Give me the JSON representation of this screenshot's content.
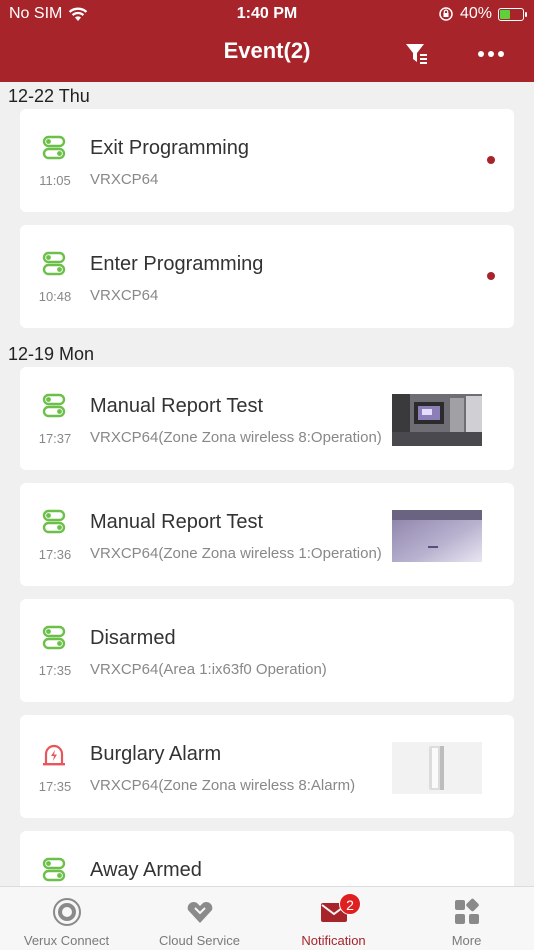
{
  "status_bar": {
    "carrier": "No SIM",
    "time": "1:40 PM",
    "battery": "40%",
    "battery_level": 0.4
  },
  "nav": {
    "title": "Event(2)",
    "filter_icon": "filter-icon",
    "more_icon": "more-icon"
  },
  "groups": [
    {
      "date": "12-22 Thu",
      "events": [
        {
          "title": "Exit Programming",
          "time": "11:05",
          "detail": "VRXCP64",
          "unread": true,
          "icon": "programming-icon"
        },
        {
          "title": "Enter Programming",
          "time": "10:48",
          "detail": "VRXCP64",
          "unread": true,
          "icon": "programming-icon"
        }
      ]
    },
    {
      "date": "12-19 Mon",
      "events": [
        {
          "title": "Manual Report Test",
          "time": "17:37",
          "detail": "VRXCP64(Zone Zona wireless 8:Operation)",
          "thumbnail": "room-camera-snapshot",
          "icon": "programming-icon"
        },
        {
          "title": "Manual Report Test",
          "time": "17:36",
          "detail": "VRXCP64(Zone Zona wireless 1:Operation)",
          "thumbnail": "ceiling-camera-snapshot",
          "icon": "programming-icon"
        },
        {
          "title": "Disarmed",
          "time": "17:35",
          "detail": "VRXCP64(Area 1:ix63f0 Operation)",
          "icon": "programming-icon"
        },
        {
          "title": "Burglary Alarm",
          "time": "17:35",
          "detail": "VRXCP64(Zone Zona wireless 8:Alarm)",
          "thumbnail": "sensor-device-photo",
          "icon": "alarm-icon"
        },
        {
          "title": "Away Armed",
          "time": "",
          "detail": "",
          "icon": "programming-icon"
        }
      ]
    }
  ],
  "tabs": [
    {
      "label": "Verux Connect",
      "icon": "device-icon"
    },
    {
      "label": "Cloud Service",
      "icon": "cloud-heart-icon"
    },
    {
      "label": "Notification",
      "icon": "mail-icon",
      "badge": "2",
      "active": true
    },
    {
      "label": "More",
      "icon": "apps-grid-icon"
    }
  ],
  "colors": {
    "brand": "#a8242b",
    "icon_green": "#6cc04a",
    "alarm_red": "#e8555a",
    "badge": "#e02020"
  }
}
